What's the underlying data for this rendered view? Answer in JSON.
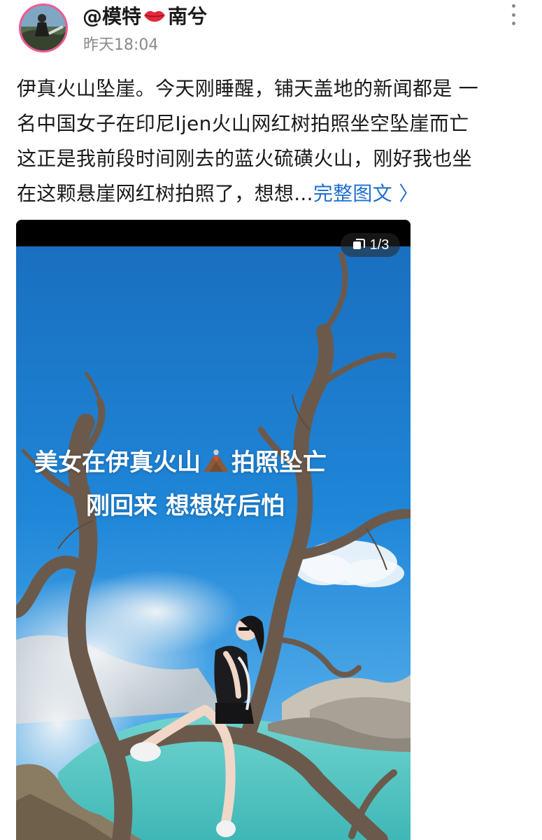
{
  "header": {
    "username_prefix": "@模特",
    "username_suffix": "南兮",
    "time": "昨天18:04",
    "avatar_icon": "avatar-photo",
    "more_icon": "vertical-ellipsis-icon"
  },
  "post": {
    "lines": [
      "伊真火山坠崖。今天刚睡醒，铺天盖地的新闻都是 一",
      "名中国女子在印尼Ijen火山网红树拍照坐空坠崖而亡",
      "这正是我前段时间刚去的蓝火硫磺火山，刚好我也坐",
      "在这颗悬崖网红树拍照了，想想..."
    ],
    "full_text_link": "完整图文 〉"
  },
  "image": {
    "counter": "1/3",
    "overlay_line1_a": "美女在伊真火山",
    "overlay_line1_b": "拍照坠亡",
    "overlay_line2": "刚回来 想想好后怕"
  },
  "colors": {
    "link": "#1f6fd1",
    "avatar_ring": "#f05a94",
    "time_gray": "#8a8a8a"
  }
}
